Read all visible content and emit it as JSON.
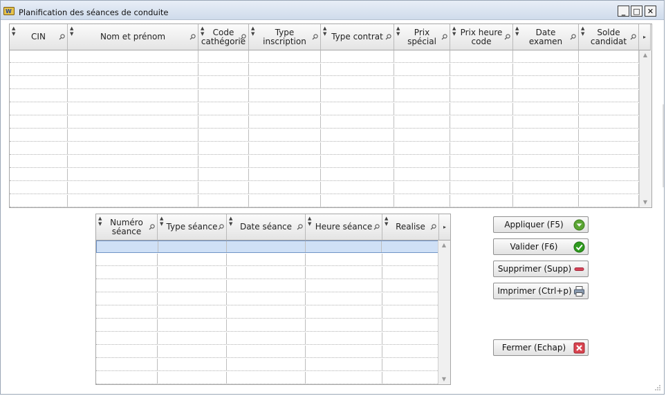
{
  "window": {
    "title": "Planification des séances de conduite",
    "controls": {
      "minimize": "_",
      "maximize": "□",
      "close": "✕"
    }
  },
  "candidates_table": {
    "columns": [
      "CIN",
      "Nom et prénom",
      "Code cathégorie",
      "Type inscription",
      "Type contrat",
      "Prix spécial",
      "Prix heure code",
      "Date examen",
      "Solde candidat"
    ],
    "rows": []
  },
  "sessions_table": {
    "columns": [
      "Numéro séance",
      "Type séance",
      "Date séance",
      "Heure séance",
      "Realise"
    ],
    "rows": []
  },
  "buttons": {
    "apply": "Appliquer (F5)",
    "validate": "Valider (F6)",
    "delete": "Supprimer (Supp)",
    "print": "Imprimer (Ctrl+p)",
    "close": "Fermer (Echap)"
  },
  "colors": {
    "titlebar": "#d7e2f0",
    "selected_row": "#cfe0f6",
    "apply_icon": "#5aa532",
    "validate_icon": "#2e9b1e",
    "delete_icon": "#d6455a",
    "close_icon": "#d9434f"
  },
  "icons": {
    "apply": "arrow-down-circle-icon",
    "validate": "check-circle-icon",
    "delete": "minus-icon",
    "print": "printer-icon",
    "close": "x-box-icon"
  }
}
